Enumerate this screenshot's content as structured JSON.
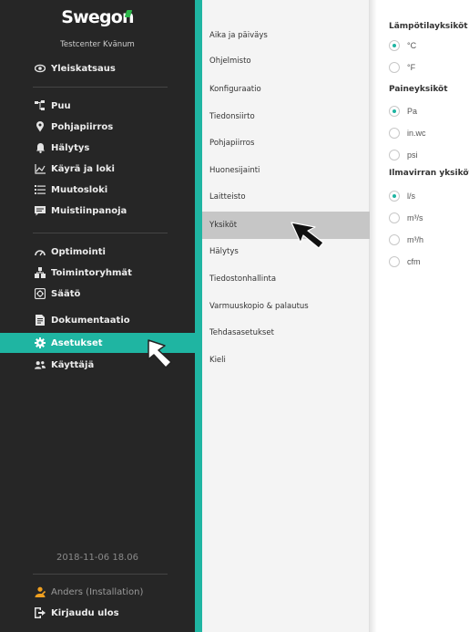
{
  "sidebar": {
    "logo_text": "Swegon",
    "site_name": "Testcenter Kvänum",
    "items": [
      {
        "label": "Yleiskatsaus",
        "icon": "eye-icon"
      },
      {
        "label": "Puu",
        "icon": "tree-icon"
      },
      {
        "label": "Pohjapiirros",
        "icon": "map-pin-icon"
      },
      {
        "label": "Hälytys",
        "icon": "bell-icon"
      },
      {
        "label": "Käyrä ja loki",
        "icon": "chart-line-icon"
      },
      {
        "label": "Muutosloki",
        "icon": "list-icon"
      },
      {
        "label": "Muistiinpanoja",
        "icon": "note-icon"
      },
      {
        "label": "Optimointi",
        "icon": "gauge-icon"
      },
      {
        "label": "Toimintoryhmät",
        "icon": "group-icon"
      },
      {
        "label": "Säätö",
        "icon": "control-icon"
      },
      {
        "label": "Dokumentaatio",
        "icon": "document-icon"
      },
      {
        "label": "Asetukset",
        "icon": "gear-icon",
        "active": true
      },
      {
        "label": "Käyttäjä",
        "icon": "users-icon"
      }
    ],
    "datetime": "2018-11-06 18.06",
    "user": "Anders (Installation)",
    "logout": "Kirjaudu ulos"
  },
  "submenu": {
    "items": [
      {
        "label": "Aika ja päiväys"
      },
      {
        "label": "Ohjelmisto"
      },
      {
        "label": "Konfiguraatio"
      },
      {
        "label": "Tiedonsiirto"
      },
      {
        "label": "Pohjapiirros"
      },
      {
        "label": "Huonesijainti"
      },
      {
        "label": "Laitteisto"
      },
      {
        "label": "Yksiköt",
        "active": true
      },
      {
        "label": "Hälytys"
      },
      {
        "label": "Tiedostonhallinta"
      },
      {
        "label": "Varmuuskopio & palautus"
      },
      {
        "label": "Tehdasasetukset"
      },
      {
        "label": "Kieli"
      }
    ]
  },
  "settings": {
    "temperature": {
      "title": "Lämpötilayksiköt",
      "options": [
        {
          "label": "°C",
          "checked": true
        },
        {
          "label": "°F",
          "checked": false
        }
      ]
    },
    "pressure": {
      "title": "Paineyksiköt",
      "options": [
        {
          "label": "Pa",
          "checked": true
        },
        {
          "label": "in.wc",
          "checked": false
        },
        {
          "label": "psi",
          "checked": false
        }
      ]
    },
    "airflow": {
      "title": "Ilmavirran yksiköt",
      "options": [
        {
          "label": "l/s",
          "checked": true
        },
        {
          "label": "m³/s",
          "checked": false
        },
        {
          "label": "m³/h",
          "checked": false
        },
        {
          "label": "cfm",
          "checked": false
        }
      ]
    }
  },
  "colors": {
    "accent": "#1fb5a2",
    "sidebar_bg": "#262626",
    "user_icon": "#f0a020"
  }
}
